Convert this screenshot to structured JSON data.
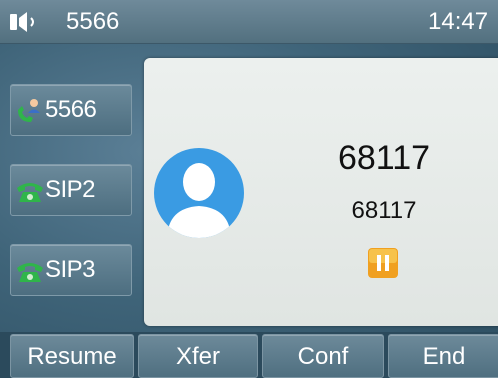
{
  "status_bar": {
    "speaker_icon": "speakerphone-icon",
    "account": "5566",
    "time": "14:47"
  },
  "line_keys": [
    {
      "label": "5566",
      "icon": "contact-phone-icon",
      "color": "#2fb54a"
    },
    {
      "label": "SIP2",
      "icon": "phone-icon",
      "color": "#2fb54a"
    },
    {
      "label": "SIP3",
      "icon": "phone-icon",
      "color": "#2fb54a"
    }
  ],
  "call": {
    "avatar_icon": "contact-avatar-icon",
    "name": "68117",
    "number": "68117",
    "status_icon": "hold-icon",
    "hold_color": "#f0a020"
  },
  "softkeys": [
    "Resume",
    "Xfer",
    "Conf",
    "End"
  ]
}
